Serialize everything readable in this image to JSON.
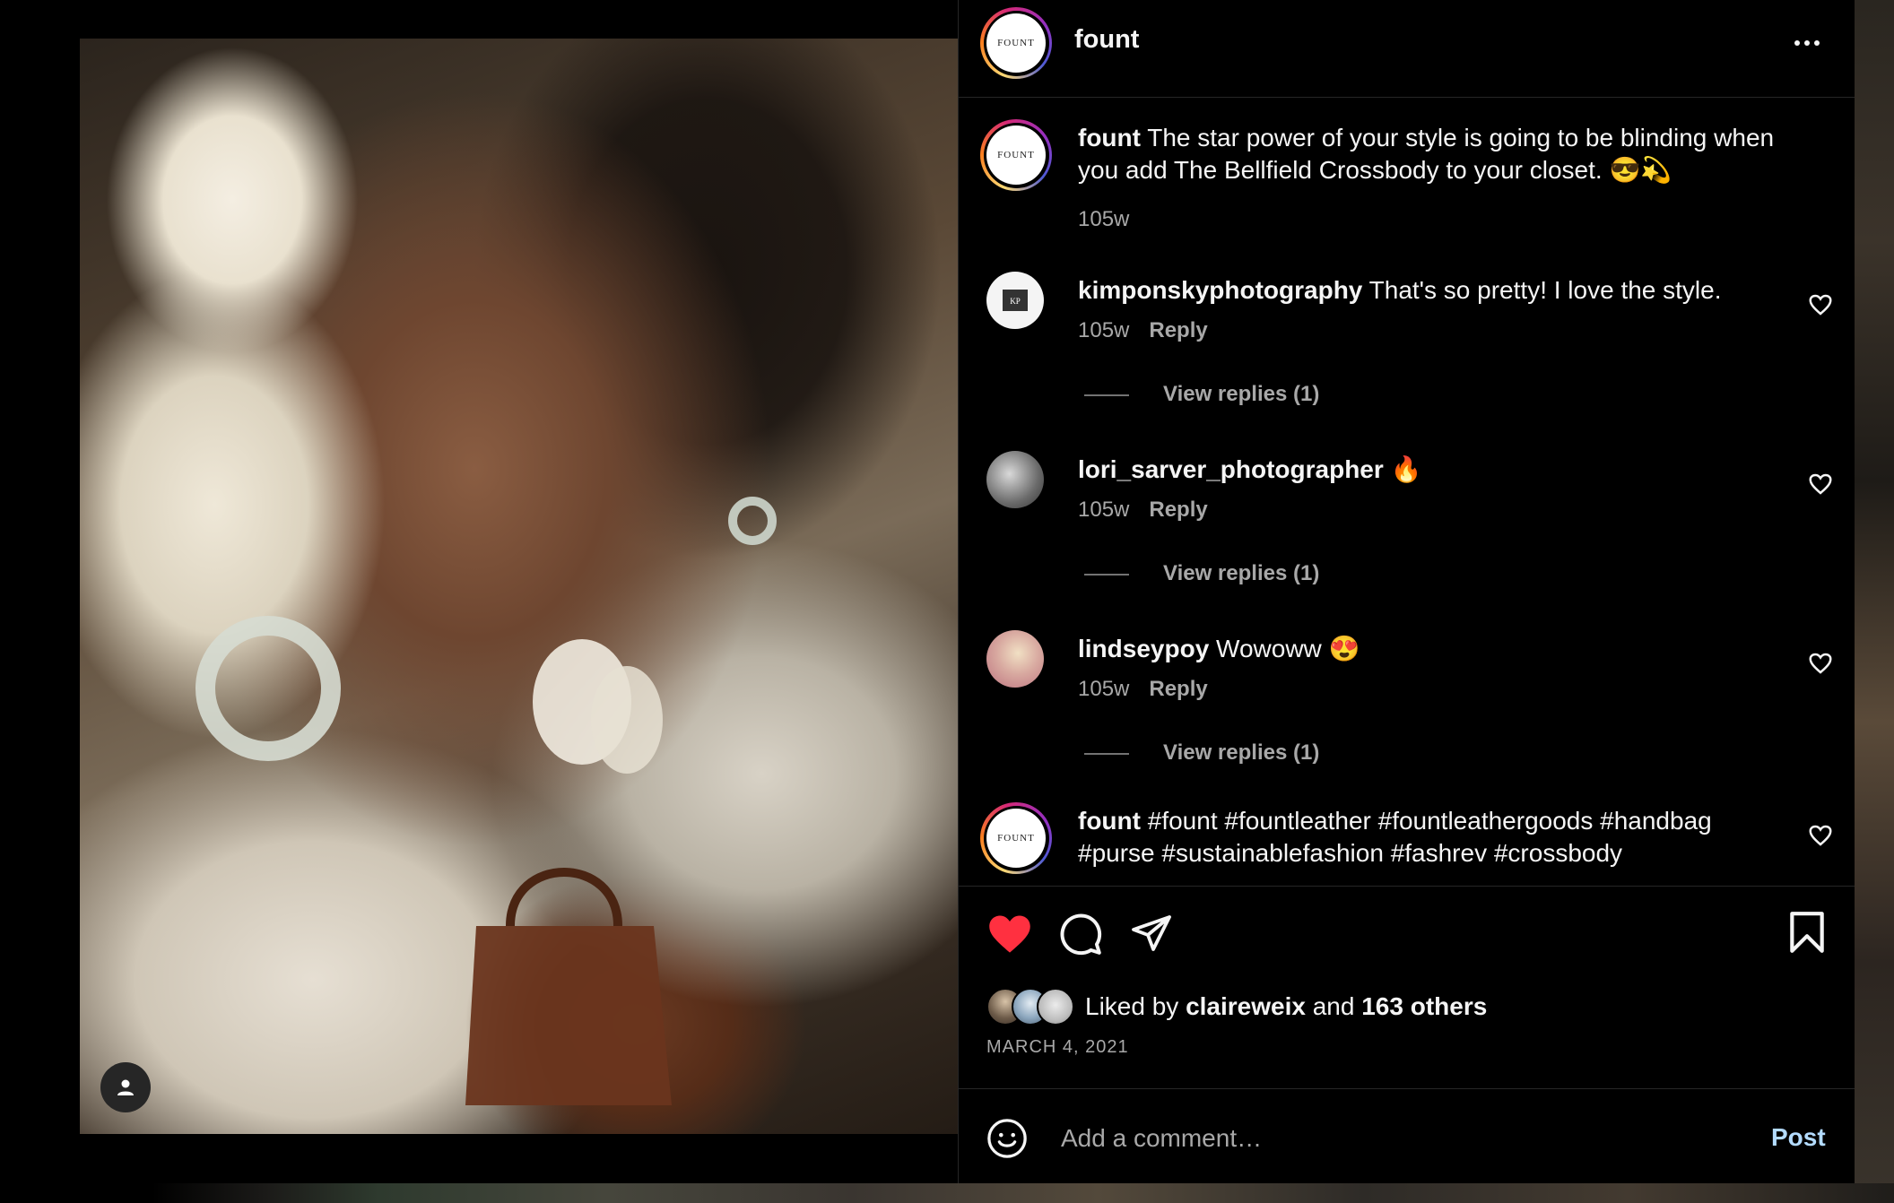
{
  "post": {
    "username": "fount",
    "logo_text": "FOUNT"
  },
  "caption": {
    "user": "fount",
    "text": "The star power of your style is going to be blinding when you add The Bellfield Crossbody to your closet. 😎💫",
    "time": "105w"
  },
  "comments": [
    {
      "user": "kimponskyphotography",
      "text": "That's so pretty! I love the style.",
      "time": "105w",
      "reply_label": "Reply",
      "view_replies": "View replies (1)"
    },
    {
      "user": "lori_sarver_photographer",
      "text": "🔥",
      "time": "105w",
      "reply_label": "Reply",
      "view_replies": "View replies (1)"
    },
    {
      "user": "lindseypoy",
      "text": "Wowoww 😍",
      "time": "105w",
      "reply_label": "Reply",
      "view_replies": "View replies (1)"
    },
    {
      "user": "fount",
      "text": "#fount #fountleather #fountleathergoods #handbag #purse #sustainablefashion #fashrev #crossbody"
    }
  ],
  "likes": {
    "prefix": "Liked by",
    "user": "claireweix",
    "connector": "and",
    "others": "163 others"
  },
  "date": "MARCH 4, 2021",
  "comment_box": {
    "placeholder": "Add a comment…",
    "post_label": "Post"
  },
  "colors": {
    "like_red": "#ff3040",
    "post_blue": "#b3dbff",
    "muted": "#a8a8a8",
    "divider": "#262626"
  },
  "icons": [
    "more-icon",
    "heart-icon",
    "comment-icon",
    "share-icon",
    "bookmark-icon",
    "emoji-icon",
    "user-tag-icon"
  ]
}
